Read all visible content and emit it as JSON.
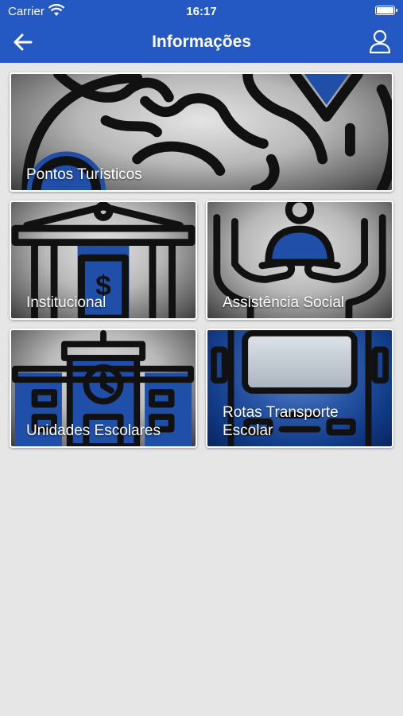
{
  "status_bar": {
    "carrier": "Carrier",
    "time": "16:17"
  },
  "header": {
    "title": "Informações",
    "back_icon": "arrow-left-icon",
    "profile_icon": "user-icon"
  },
  "tiles": [
    {
      "label": "Pontos Turísticos",
      "icon": "map-icon"
    },
    {
      "label": "Institucional",
      "icon": "government-building-icon"
    },
    {
      "label": "Assistência Social",
      "icon": "helping-hands-icon"
    },
    {
      "label": "Unidades Escolares",
      "icon": "school-building-icon"
    },
    {
      "label": "Rotas Transporte Escolar",
      "icon": "school-bus-icon"
    }
  ],
  "colors": {
    "header": "#2458c2",
    "background": "#e6e6e6",
    "accent_blue": "#1f4fa8"
  }
}
